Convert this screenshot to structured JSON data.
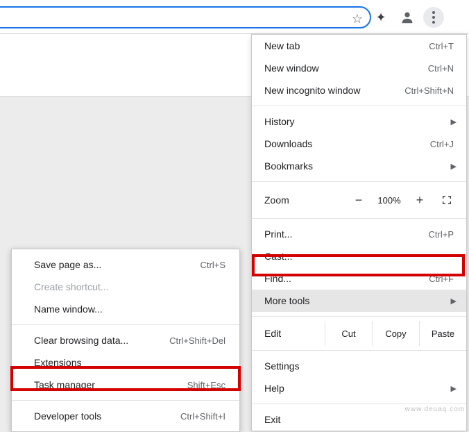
{
  "toolbar": {
    "omnibox_value": "",
    "star_name": "bookmark-star",
    "ext_name": "extensions",
    "avatar_name": "profile",
    "menu_name": "chrome-menu"
  },
  "main_menu": {
    "new_tab": {
      "label": "New tab",
      "short": "Ctrl+T"
    },
    "new_window": {
      "label": "New window",
      "short": "Ctrl+N"
    },
    "new_incognito": {
      "label": "New incognito window",
      "short": "Ctrl+Shift+N"
    },
    "history": {
      "label": "History"
    },
    "downloads": {
      "label": "Downloads",
      "short": "Ctrl+J"
    },
    "bookmarks": {
      "label": "Bookmarks"
    },
    "zoom": {
      "label": "Zoom",
      "pct": "100%"
    },
    "print": {
      "label": "Print...",
      "short": "Ctrl+P"
    },
    "cast": {
      "label": "Cast..."
    },
    "find": {
      "label": "Find...",
      "short": "Ctrl+F"
    },
    "more_tools": {
      "label": "More tools"
    },
    "edit": {
      "label": "Edit",
      "cut": "Cut",
      "copy": "Copy",
      "paste": "Paste"
    },
    "settings": {
      "label": "Settings"
    },
    "help": {
      "label": "Help"
    },
    "exit": {
      "label": "Exit"
    }
  },
  "sub_menu": {
    "save_page": {
      "label": "Save page as...",
      "short": "Ctrl+S"
    },
    "create_shortcut": {
      "label": "Create shortcut..."
    },
    "name_window": {
      "label": "Name window..."
    },
    "clear_data": {
      "label": "Clear browsing data...",
      "short": "Ctrl+Shift+Del"
    },
    "extensions": {
      "label": "Extensions"
    },
    "task_manager": {
      "label": "Task manager",
      "short": "Shift+Esc"
    },
    "dev_tools": {
      "label": "Developer tools",
      "short": "Ctrl+Shift+I"
    }
  },
  "watermark": "www.deuaq.com"
}
